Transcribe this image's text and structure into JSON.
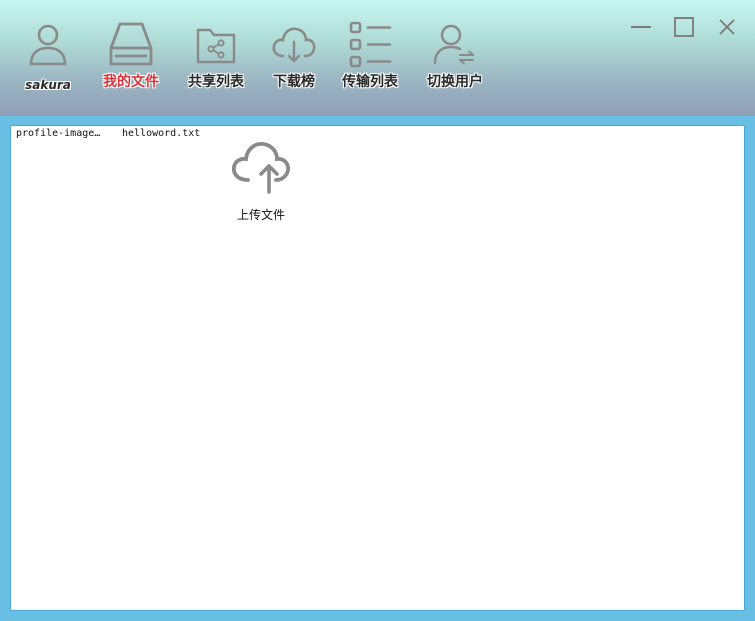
{
  "toolbar": {
    "user": {
      "name": "sakura",
      "icon": "user-icon"
    },
    "items": [
      {
        "label": "我的文件",
        "icon": "drive-icon",
        "active": true
      },
      {
        "label": "共享列表",
        "icon": "shared-folder-icon"
      },
      {
        "label": "下载榜",
        "icon": "cloud-download-icon"
      },
      {
        "label": "传输列表",
        "icon": "list-icon"
      },
      {
        "label": "切换用户",
        "icon": "switch-user-icon"
      }
    ]
  },
  "window_controls": {
    "minimize": "minimize-icon",
    "maximize": "maximize-icon",
    "close": "close-icon"
  },
  "files": [
    {
      "name": "profile-image…"
    },
    {
      "name": "helloword.txt"
    }
  ],
  "upload": {
    "label": "上传文件",
    "icon": "cloud-upload-icon"
  },
  "colors": {
    "active_label": "#d9323a",
    "icon_gray": "#8a8a8a",
    "frame": "#68bfe3"
  }
}
